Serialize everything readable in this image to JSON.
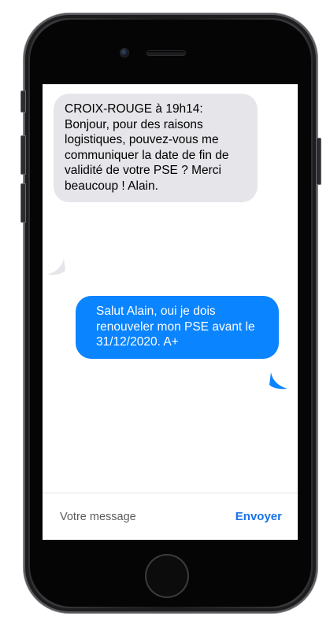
{
  "conversation": {
    "received_message": "CROIX-ROUGE à 19h14:\nBonjour, pour des raisons logistiques, pouvez-vous me communiquer la date de fin de validité de votre PSE ? Merci beaucoup ! Alain.",
    "sent_message": "Salut Alain, oui je dois renouveler mon PSE avant le 31/12/2020. A+"
  },
  "compose": {
    "placeholder": "Votre message",
    "value": "",
    "send_label": "Envoyer"
  },
  "colors": {
    "received_bubble": "#e5e5ea",
    "sent_bubble": "#0a84ff",
    "send_accent": "#1a73e8"
  },
  "icons": {
    "camera": "front-camera-icon",
    "speaker": "earpiece-speaker-icon",
    "home": "home-button-icon"
  }
}
